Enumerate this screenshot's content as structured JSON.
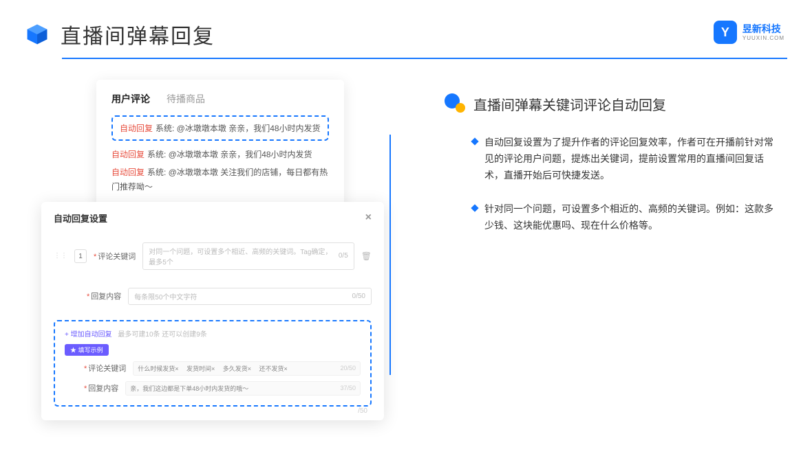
{
  "header": {
    "title": "直播间弹幕回复",
    "brand_cn": "昱新科技",
    "brand_en": "YUUXIN.COM",
    "brand_letter": "Y"
  },
  "card1": {
    "tab_active": "用户评论",
    "tab_inactive": "待播商品",
    "highlighted": {
      "tag": "自动回复",
      "rest": "系统: @冰墩墩本墩 亲亲，我们48小时内发货"
    },
    "lines": [
      {
        "tag": "自动回复",
        "rest": "系统: @冰墩墩本墩 亲亲，我们48小时内发货"
      },
      {
        "tag": "自动回复",
        "rest": "系统: @冰墩墩本墩 关注我们的店铺，每日都有热门推荐呦～"
      }
    ]
  },
  "card2": {
    "title": "自动回复设置",
    "idx": "1",
    "label_keyword": "评论关键词",
    "placeholder_keyword": "对同一个问题，可设置多个相近、高频的关键词。Tag确定，最多5个",
    "count_keyword": "0/5",
    "label_content": "回复内容",
    "placeholder_content": "每条限50个中文字符",
    "count_content": "0/50",
    "add_link": "+ 增加自动回复",
    "add_hint": "最多可建10条 还可以创建9条",
    "badge": "★ 填写示例",
    "ex_label_keyword": "评论关键词",
    "ex_tags": "什么时候发货× 　发货时间× 　多久发货× 　还不发货×",
    "ex_count_keyword": "20/50",
    "ex_label_content": "回复内容",
    "ex_content": "亲，我们这边都是下单48小时内发货的哦～",
    "ex_count_content": "37/50",
    "below_count": "/50"
  },
  "right": {
    "title": "直播间弹幕关键词评论自动回复",
    "bullets": [
      "自动回复设置为了提升作者的评论回复效率，作者可在开播前针对常见的评论用户问题，提炼出关键词，提前设置常用的直播间回复话术，直播开始后可快捷发送。",
      "针对同一个问题，可设置多个相近的、高频的关键词。例如：这款多少钱、这块能优惠吗、现在什么价格等。"
    ]
  }
}
